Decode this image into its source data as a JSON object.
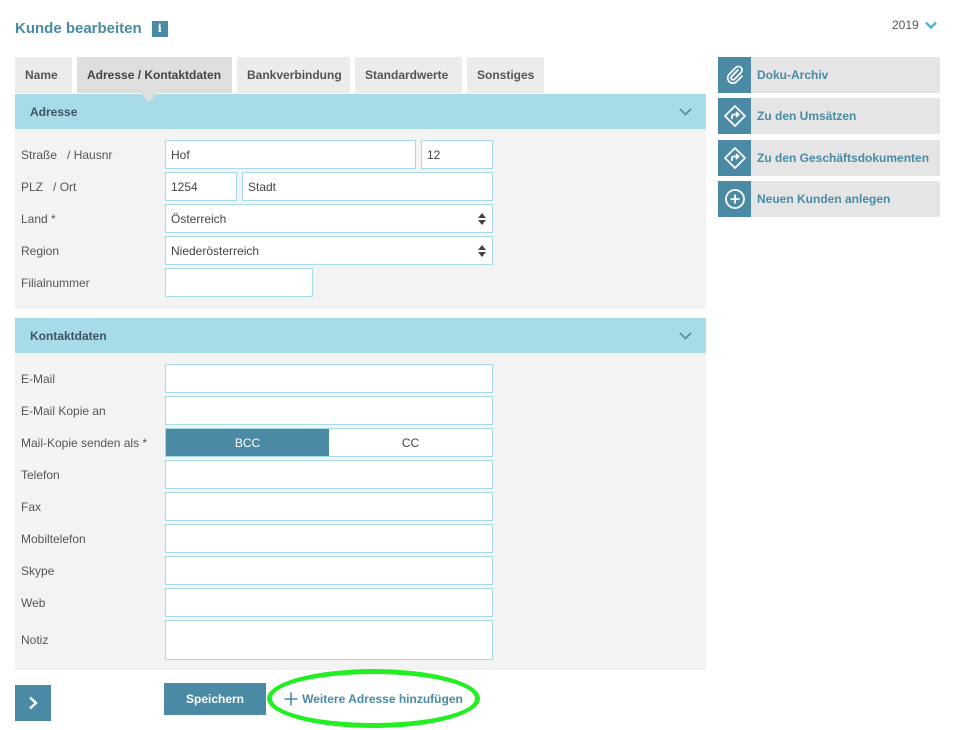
{
  "header": {
    "title": "Kunde bearbeiten",
    "info_icon": "i",
    "year": "2019"
  },
  "tabs": [
    {
      "label": "Name"
    },
    {
      "label": "Adresse / Kontaktdaten"
    },
    {
      "label": "Bankverbindung"
    },
    {
      "label": "Standardwerte"
    },
    {
      "label": "Sonstiges"
    }
  ],
  "address": {
    "section_title": "Adresse",
    "street_label": "Straße",
    "street_sep": "/ Hausnr",
    "street_value": "Hof",
    "house_number_value": "12",
    "zip_label": "PLZ",
    "zip_sep": "/ Ort",
    "zip_value": "1254",
    "city_value": "Stadt",
    "country_label": "Land",
    "country_value": "Österreich",
    "region_label": "Region",
    "region_value": "Niederösterreich",
    "branch_label": "Filialnummer",
    "branch_value": "",
    "required_mark": "*"
  },
  "contact": {
    "section_title": "Kontaktdaten",
    "email_label": "E-Mail",
    "email_copy_label": "E-Mail Kopie an",
    "mail_copy_mode_label": "Mail-Kopie senden als",
    "required_mark": "*",
    "mode_bcc": "BCC",
    "mode_cc": "CC",
    "phone_label": "Telefon",
    "fax_label": "Fax",
    "mobile_label": "Mobiltelefon",
    "skype_label": "Skype",
    "web_label": "Web",
    "note_label": "Notiz"
  },
  "sidebar": {
    "items": [
      {
        "label": "Doku-Archiv",
        "icon": "paperclip-icon"
      },
      {
        "label": "Zu den Umsätzen",
        "icon": "turn-right-icon"
      },
      {
        "label": "Zu den Geschäftsdokumenten",
        "icon": "turn-right-icon"
      },
      {
        "label": "Neuen Kunden anlegen",
        "icon": "plus-circle-icon"
      }
    ]
  },
  "footer": {
    "save_label": "Speichern",
    "add_address_label": "Weitere Adresse hinzufügen"
  },
  "colors": {
    "accent": "#4a8aa5",
    "section_header": "#a8dbe8",
    "highlight": "#22ee22"
  }
}
